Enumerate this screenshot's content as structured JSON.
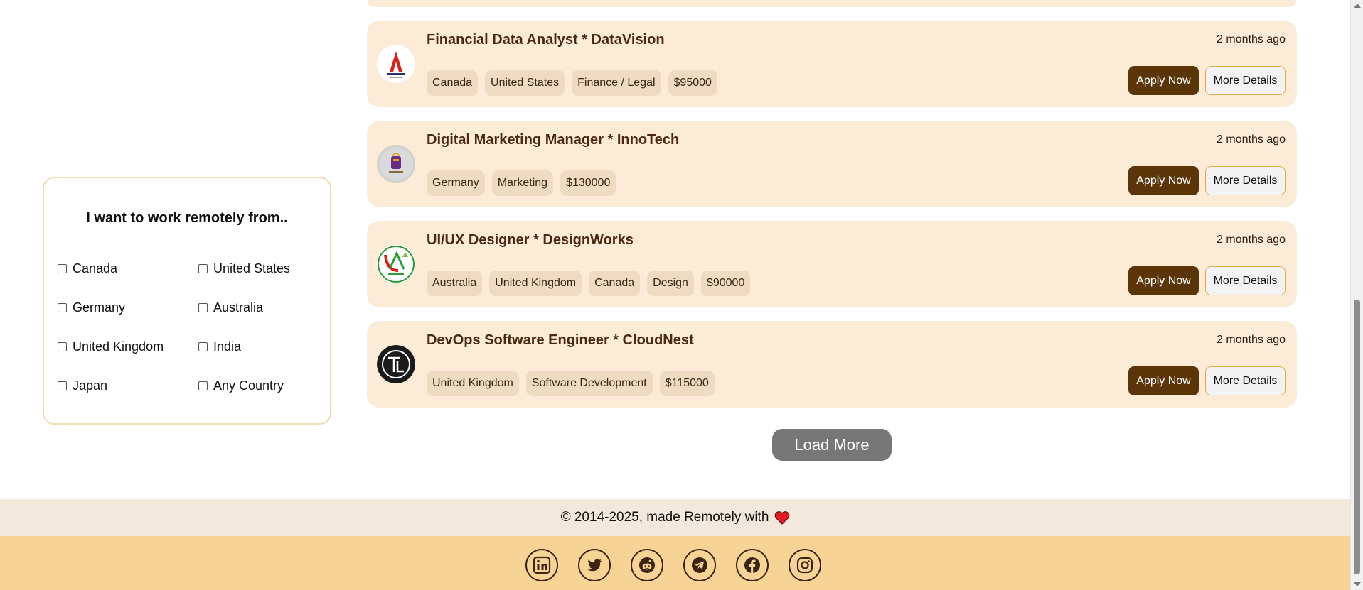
{
  "filter": {
    "title": "I want to work remotely from..",
    "options": [
      "Canada",
      "United States",
      "Germany",
      "Australia",
      "United Kingdom",
      "India",
      "Japan",
      "Any Country"
    ]
  },
  "jobs": [
    {
      "title": "Financial Data Analyst * DataVision",
      "posted": "2 months ago",
      "tags": [
        "Canada",
        "United States",
        "Finance / Legal",
        "$95000"
      ],
      "logo": "company-a-logo",
      "apply_label": "Apply Now",
      "details_label": "More Details"
    },
    {
      "title": "Digital Marketing Manager * InnoTech",
      "posted": "2 months ago",
      "tags": [
        "Germany",
        "Marketing",
        "$130000"
      ],
      "logo": "shopping-bag-logo",
      "apply_label": "Apply Now",
      "details_label": "More Details"
    },
    {
      "title": "UI/UX Designer * DesignWorks",
      "posted": "2 months ago",
      "tags": [
        "Australia",
        "United Kingdom",
        "Canada",
        "Design",
        "$90000"
      ],
      "logo": "green-company-logo",
      "apply_label": "Apply Now",
      "details_label": "More Details"
    },
    {
      "title": "DevOps Software Engineer * CloudNest",
      "posted": "2 months ago",
      "tags": [
        "United Kingdom",
        "Software Development",
        "$115000"
      ],
      "logo": "tl-logo",
      "apply_label": "Apply Now",
      "details_label": "More Details"
    }
  ],
  "load_more_label": "Load More",
  "footer": {
    "copyright": "© 2014-2025, made Remotely with",
    "heart_icon": "heart-icon",
    "socials": [
      "linkedin-icon",
      "twitter-icon",
      "reddit-icon",
      "telegram-icon",
      "facebook-icon",
      "instagram-icon"
    ]
  },
  "colors": {
    "card_bg": "#fcebd7",
    "apply_bg": "#5a3508",
    "footer_top": "#f3e8dc",
    "footer_bottom": "#f8d396",
    "load_more_bg": "#777777"
  }
}
